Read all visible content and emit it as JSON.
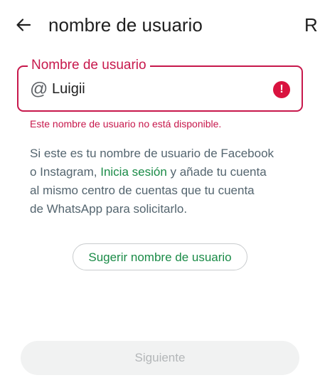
{
  "header": {
    "back_icon": "arrow-left-icon",
    "title": "nombre de usuario",
    "right_partial": "R"
  },
  "field": {
    "label": "Nombre de usuario",
    "prefix": "@",
    "value": "Luigii",
    "error_icon": "exclamation-circle-icon",
    "error_message": "Este nombre de usuario no está disponible."
  },
  "info": {
    "line1": "Si este es tu nombre de usuario de Facebook",
    "line2_before": "o Instagram, ",
    "line2_link": "Inicia sesión",
    "line2_after": " y añade tu cuenta",
    "line3": "al mismo centro de cuentas que tu cuenta",
    "line4": "de WhatsApp para solicitarlo."
  },
  "buttons": {
    "suggest": "Sugerir nombre de usuario",
    "next": "Siguiente"
  },
  "colors": {
    "error": "#c7184c",
    "link": "#1a8b47",
    "text": "#1f1f1f",
    "secondary_text": "#54656f"
  }
}
